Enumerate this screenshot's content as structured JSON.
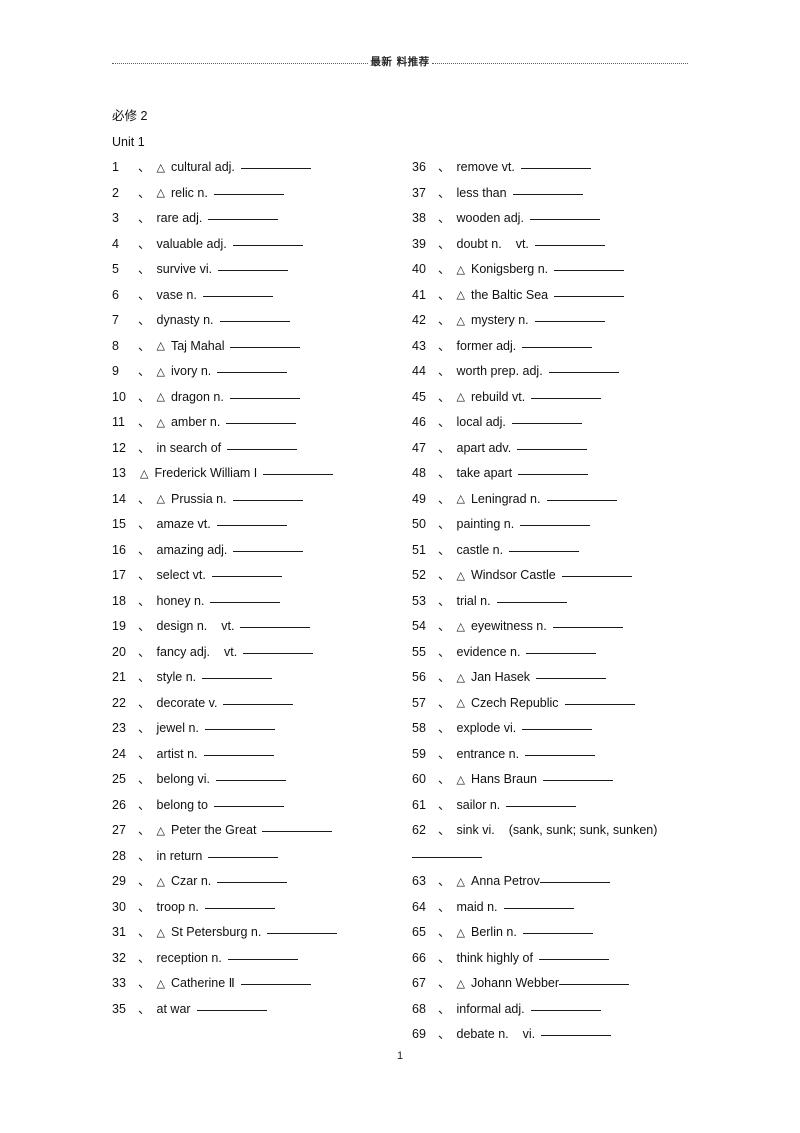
{
  "header": {
    "text": "最新 料推荐"
  },
  "headings": [
    "必修 2",
    "Unit 1"
  ],
  "footer": {
    "page_number": "1"
  },
  "columns": {
    "left": [
      {
        "num": "1",
        "sep": "、",
        "tri": true,
        "word": "cultural adj.",
        "blank": "b-70"
      },
      {
        "num": "2",
        "sep": "、",
        "tri": true,
        "word": "relic n.",
        "blank": "b-70"
      },
      {
        "num": "3",
        "sep": "、",
        "tri": false,
        "word": "rare adj.",
        "blank": "b-70"
      },
      {
        "num": "4",
        "sep": "、",
        "tri": false,
        "word": "valuable adj.",
        "blank": "b-70"
      },
      {
        "num": "5",
        "sep": "、",
        "tri": false,
        "word": "survive vi.",
        "blank": "b-70"
      },
      {
        "num": "6",
        "sep": "、",
        "tri": false,
        "word": "vase n.",
        "blank": "b-70"
      },
      {
        "num": "7",
        "sep": "、",
        "tri": false,
        "word": "dynasty n.",
        "blank": "b-70"
      },
      {
        "num": "8",
        "sep": "、",
        "tri": true,
        "word": "Taj Mahal",
        "blank": "b-70"
      },
      {
        "num": "9",
        "sep": "、",
        "tri": true,
        "word": "ivory n.",
        "blank": "b-70"
      },
      {
        "num": "10",
        "sep": "、",
        "tri": true,
        "word": "dragon n.",
        "blank": "b-70"
      },
      {
        "num": "11",
        "sep": "、",
        "tri": true,
        "word": "amber n.",
        "blank": "b-70"
      },
      {
        "num": "12",
        "sep": "、",
        "tri": false,
        "word": "in search of",
        "blank": "b-70"
      },
      {
        "num": "13",
        "sep": "",
        "tri": true,
        "word": "Frederick William I",
        "blank": "b-70"
      },
      {
        "num": "14",
        "sep": "、",
        "tri": true,
        "word": "Prussia n.",
        "blank": "b-70"
      },
      {
        "num": "15",
        "sep": "、",
        "tri": false,
        "word": "amaze vt.",
        "blank": "b-70"
      },
      {
        "num": "16",
        "sep": "、",
        "tri": false,
        "word": "amazing adj.",
        "blank": "b-70"
      },
      {
        "num": "17",
        "sep": "、",
        "tri": false,
        "word": "select vt.",
        "blank": "b-70"
      },
      {
        "num": "18",
        "sep": "、",
        "tri": false,
        "word": "honey n.",
        "blank": "b-70"
      },
      {
        "num": "19",
        "sep": "、",
        "tri": false,
        "word": "design n.",
        "word2": "vt.",
        "blank": "b-70"
      },
      {
        "num": "20",
        "sep": "、",
        "tri": false,
        "word": "fancy adj.",
        "word2": "vt.",
        "blank": "b-70"
      },
      {
        "num": "21",
        "sep": "、",
        "tri": false,
        "word": "style n.",
        "blank": "b-70"
      },
      {
        "num": "22",
        "sep": "、",
        "tri": false,
        "word": "decorate v.",
        "blank": "b-70"
      },
      {
        "num": "23",
        "sep": "、",
        "tri": false,
        "word": "jewel n.",
        "blank": "b-70"
      },
      {
        "num": "24",
        "sep": "、",
        "tri": false,
        "word": "artist n.",
        "blank": "b-70"
      },
      {
        "num": "25",
        "sep": "、",
        "tri": false,
        "word": "belong vi.",
        "blank": "b-70"
      },
      {
        "num": "26",
        "sep": "、",
        "tri": false,
        "word": "belong to",
        "blank": "b-70"
      },
      {
        "num": "27",
        "sep": "、",
        "tri": true,
        "word": "Peter the Great",
        "blank": "b-70"
      },
      {
        "num": "28",
        "sep": "、",
        "tri": false,
        "word": "in return",
        "blank": "b-70"
      },
      {
        "num": "29",
        "sep": "、",
        "tri": true,
        "word": "Czar n.",
        "blank": "b-70"
      },
      {
        "num": "30",
        "sep": "、",
        "tri": false,
        "word": "troop n.",
        "blank": "b-70"
      },
      {
        "num": "31",
        "sep": "、",
        "tri": true,
        "word": "St Petersburg n.",
        "blank": "b-70"
      },
      {
        "num": "32",
        "sep": "、",
        "tri": false,
        "word": "reception n.",
        "blank": "b-70"
      },
      {
        "num": "33",
        "sep": "、",
        "tri": true,
        "word": "Catherine Ⅱ",
        "blank": "b-70"
      },
      {
        "num": "35",
        "sep": "、",
        "tri": false,
        "word": "at war",
        "blank": "b-70"
      }
    ],
    "right": [
      {
        "num": "36",
        "sep": "、",
        "tri": false,
        "word": "remove vt.",
        "blank": "b-70"
      },
      {
        "num": "37",
        "sep": "、",
        "tri": false,
        "word": "less than",
        "blank": "b-70"
      },
      {
        "num": "38",
        "sep": "、",
        "tri": false,
        "word": "wooden adj.",
        "blank": "b-70"
      },
      {
        "num": "39",
        "sep": "、",
        "tri": false,
        "word": "doubt n.",
        "word2": "vt.",
        "blank": "b-70"
      },
      {
        "num": "40",
        "sep": "、",
        "tri": true,
        "word": "Konigsberg n.",
        "blank": "b-70"
      },
      {
        "num": "41",
        "sep": "、",
        "tri": true,
        "word": "the Baltic Sea",
        "blank": "b-70"
      },
      {
        "num": "42",
        "sep": "、",
        "tri": true,
        "word": "mystery n.",
        "blank": "b-70"
      },
      {
        "num": "43",
        "sep": "、",
        "tri": false,
        "word": "former adj.",
        "blank": "b-70"
      },
      {
        "num": "44",
        "sep": "、",
        "tri": false,
        "word": "worth prep. adj.",
        "blank": "b-70"
      },
      {
        "num": "45",
        "sep": "、",
        "tri": true,
        "word": "rebuild vt.",
        "blank": "b-70"
      },
      {
        "num": "46",
        "sep": "、",
        "tri": false,
        "word": "local adj.",
        "blank": "b-70"
      },
      {
        "num": "47",
        "sep": "、",
        "tri": false,
        "word": "apart adv.",
        "blank": "b-70"
      },
      {
        "num": "48",
        "sep": "、",
        "tri": false,
        "word": "take apart",
        "blank": "b-70"
      },
      {
        "num": "49",
        "sep": "、",
        "tri": true,
        "word": "Leningrad n.",
        "blank": "b-70"
      },
      {
        "num": "50",
        "sep": "、",
        "tri": false,
        "word": "painting n.",
        "blank": "b-70"
      },
      {
        "num": "51",
        "sep": "、",
        "tri": false,
        "word": "castle n.",
        "blank": "b-70"
      },
      {
        "num": "52",
        "sep": "、",
        "tri": true,
        "word": "Windsor Castle",
        "blank": "b-70"
      },
      {
        "num": "53",
        "sep": "、",
        "tri": false,
        "word": "trial n.",
        "blank": "b-70"
      },
      {
        "num": "54",
        "sep": "、",
        "tri": true,
        "word": "eyewitness n.",
        "blank": "b-70"
      },
      {
        "num": "55",
        "sep": "、",
        "tri": false,
        "word": "evidence n.",
        "blank": "b-70"
      },
      {
        "num": "56",
        "sep": "、",
        "tri": true,
        "word": "Jan Hasek",
        "blank": "b-70"
      },
      {
        "num": "57",
        "sep": "、",
        "tri": true,
        "word": "Czech Republic",
        "blank": "b-70"
      },
      {
        "num": "58",
        "sep": "、",
        "tri": false,
        "word": "explode vi.",
        "blank": "b-70"
      },
      {
        "num": "59",
        "sep": "、",
        "tri": false,
        "word": "entrance n.",
        "blank": "b-70"
      },
      {
        "num": "60",
        "sep": "、",
        "tri": true,
        "word": "Hans Braun",
        "blank": "b-70"
      },
      {
        "num": "61",
        "sep": "、",
        "tri": false,
        "word": "sailor n.",
        "blank": "b-70"
      },
      {
        "num": "62",
        "sep": "、",
        "tri": false,
        "word": "sink  vi.",
        "note": "(sank, sunk; sunk, sunken)",
        "wrapblank": "b-70"
      },
      {
        "num": "63",
        "sep": "、",
        "tri": true,
        "word": "Anna Petrov",
        "blank": "b-70",
        "tight": true
      },
      {
        "num": "64",
        "sep": "、",
        "tri": false,
        "word": "maid n.",
        "blank": "b-70"
      },
      {
        "num": "65",
        "sep": "、",
        "tri": true,
        "word": "Berlin n.",
        "blank": "b-70"
      },
      {
        "num": "66",
        "sep": "、",
        "tri": false,
        "word": "think highly of",
        "blank": "b-70"
      },
      {
        "num": "67",
        "sep": "、",
        "tri": true,
        "word": "Johann Webber",
        "blank": "b-70",
        "tight": true
      },
      {
        "num": "68",
        "sep": "、",
        "tri": false,
        "word": "informal adj.",
        "blank": "b-70"
      },
      {
        "num": "69",
        "sep": "、",
        "tri": false,
        "word": "debate n.",
        "word2": "vi.",
        "blank": "b-70"
      }
    ]
  }
}
